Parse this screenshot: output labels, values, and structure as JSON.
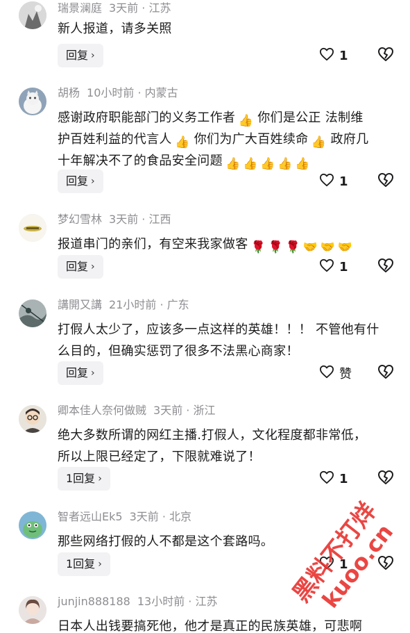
{
  "comments": [
    {
      "user": "瑞景澜庭",
      "time": "3天前",
      "location": "江苏",
      "lines": [
        "新人报道，请多关照"
      ],
      "reply_label": "回复",
      "likes": "1"
    },
    {
      "user": "胡杨",
      "time": "10小时前",
      "location": "内蒙古",
      "lines": [
        "感谢政府职能部门的义务工作者",
        "你们是公正 法制维",
        "护百姓利益的代言人",
        "你们为广大百姓续命",
        "政府几",
        "十年解决不了的食品安全问题"
      ],
      "reply_label": "回复",
      "likes": "1"
    },
    {
      "user": "梦幻雪林",
      "time": "3天前",
      "location": "江西",
      "lines": [
        "报道串门的亲们，有空来我家做客"
      ],
      "reply_label": "回复",
      "likes": "1"
    },
    {
      "user": "講開又講",
      "time": "21小时前",
      "location": "广东",
      "lines": [
        "打假人太少了，应该多一点这样的英雄！！！ 不管他有什",
        "么目的，但确实惩罚了很多不法黑心商家！"
      ],
      "reply_label": "回复",
      "likes": "赞"
    },
    {
      "user": "卿本佳人奈何做贼",
      "time": "3天前",
      "location": "浙江",
      "lines": [
        "绝大多数所谓的网红主播.打假人，文化程度都非常低，",
        "所以上限已经定了，下限就难说了！"
      ],
      "reply_label": "1回复",
      "likes": "1"
    },
    {
      "user": "智者远山Ek5",
      "time": "3天前",
      "location": "北京",
      "lines": [
        "那些网络打假的人不都是这个套路吗。"
      ],
      "reply_label": "1回复",
      "likes": "1"
    },
    {
      "user": "junjin888188",
      "time": "13小时前",
      "location": "江苏",
      "lines": [
        "日本人出钱要搞死他，他才是真正的民族英雄，可悲啊"
      ],
      "reply_label": "",
      "likes": ""
    }
  ],
  "icons": {
    "like": "heart-outline-icon",
    "dislike": "broken-heart-icon",
    "chevron": "chevron-right-icon"
  },
  "watermark": {
    "line1": "黑料不打烊",
    "line2": "kuoo.cn",
    "color": "#e8322f"
  }
}
